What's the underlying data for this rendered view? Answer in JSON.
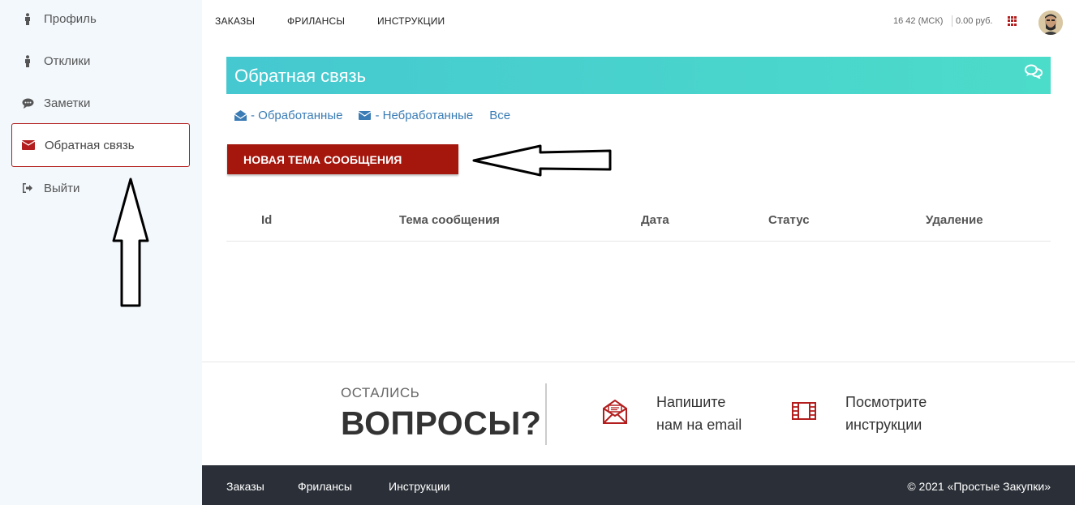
{
  "sidebar": {
    "items": [
      {
        "label": "Профиль",
        "icon": "person-icon"
      },
      {
        "label": "Отклики",
        "icon": "person-icon"
      },
      {
        "label": "Заметки",
        "icon": "comment-icon"
      },
      {
        "label": "Обратная связь",
        "icon": "envelope-icon",
        "active": true
      },
      {
        "label": "Выйти",
        "icon": "sign-out-icon"
      }
    ]
  },
  "topnav": {
    "links": [
      "ЗАКАЗЫ",
      "ФРИЛАНСЫ",
      "ИНСТРУКЦИИ"
    ],
    "time": "16 42 (МСК)",
    "balance": "0.00 руб."
  },
  "banner": {
    "title": "Обратная связь"
  },
  "filters": {
    "processed": "- Обработанные",
    "unprocessed": "- Небработанные",
    "all": "Все"
  },
  "new_topic_button": "НОВАЯ ТЕМА СООБЩЕНИЯ",
  "table": {
    "columns": [
      "Id",
      "Тема сообщения",
      "Дата",
      "Статус",
      "Удаление"
    ]
  },
  "cta": {
    "small": "ОСТАЛИСЬ",
    "big": "ВОПРОСЫ?",
    "email_line1": "Напишите",
    "email_line2": "нам на email",
    "instr_line1": "Посмотрите",
    "instr_line2": "инструкции"
  },
  "footer": {
    "links": [
      "Заказы",
      "Фрилансы",
      "Инструкции"
    ],
    "copyright": "© 2021 «Простые Закупки»"
  },
  "colors": {
    "accent": "#a5160c",
    "link": "#3a7cb5",
    "banner_start": "#45c8d0",
    "banner_end": "#4cdcca",
    "footer_bg": "#2b3038",
    "sidebar_bg": "#f3f8fc"
  }
}
